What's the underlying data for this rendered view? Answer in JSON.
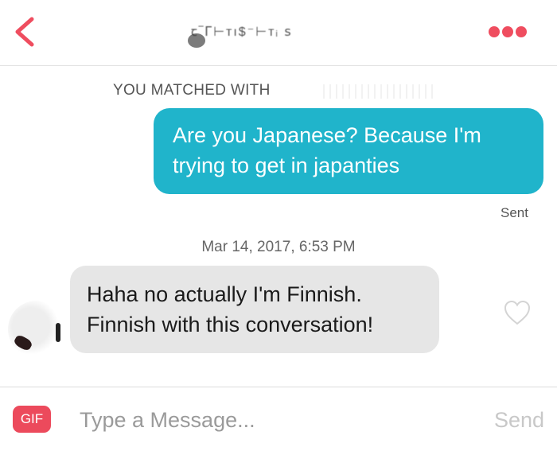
{
  "header": {
    "back_icon": "chevron-left-icon",
    "contact_name": "ꞇ‾ᒥ⊢ᴛı$⁻⊢ᴛᵢ ꜱ",
    "more_icon": "more-dots-icon",
    "accent_color": "#ef4d5f"
  },
  "match": {
    "label": "YOU MATCHED WITH"
  },
  "messages": {
    "outgoing": {
      "text": "Are you Japanese? Because I'm trying to get in japanties",
      "status": "Sent",
      "bubble_color": "#20b4cb"
    },
    "timestamp": "Mar 14, 2017, 6:53 PM",
    "incoming": {
      "text": "Haha no actually I'm Finnish. Finnish with this conversation!",
      "like_icon": "heart-outline-icon",
      "bubble_color": "#e6e6e6"
    }
  },
  "composer": {
    "gif_label": "GIF",
    "placeholder": "Type a Message...",
    "send_label": "Send"
  }
}
